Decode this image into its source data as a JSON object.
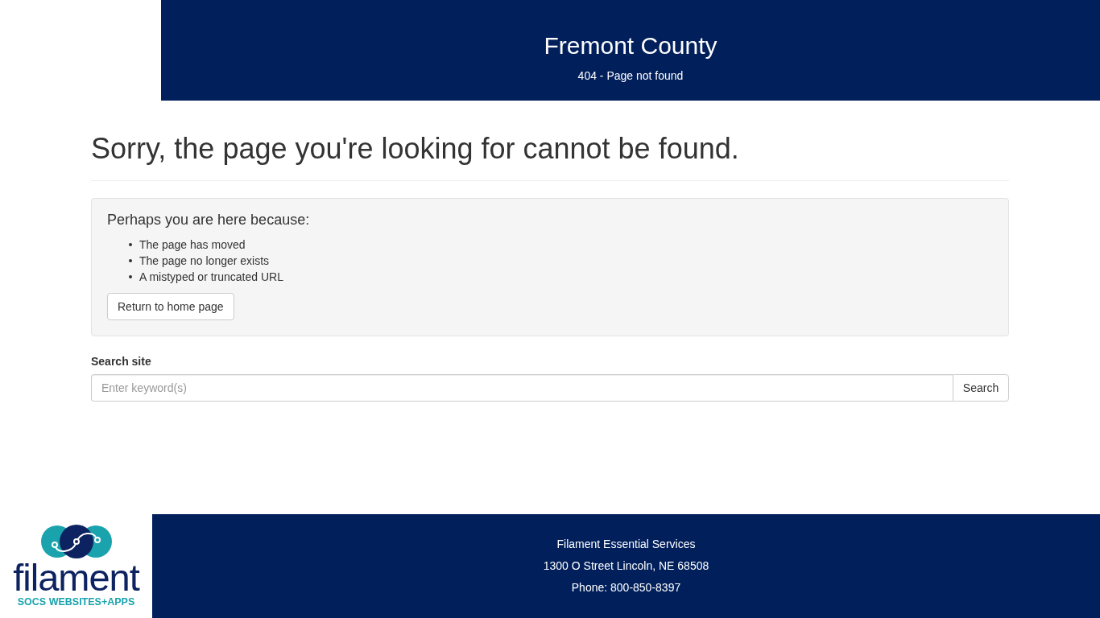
{
  "header": {
    "title": "Fremont County",
    "subtitle": "404 - Page not found"
  },
  "heading": "Sorry, the page you're looking for cannot be found.",
  "reasons_panel": {
    "title": "Perhaps you are here because:",
    "items": [
      "The page has moved",
      "The page no longer exists",
      "A mistyped or truncated URL"
    ],
    "button": "Return to home page"
  },
  "search": {
    "label": "Search site",
    "placeholder": "Enter keyword(s)",
    "button": "Search"
  },
  "footer": {
    "logo": {
      "wordmark": "filament",
      "tagline": "SOCS WEBSITES+APPS"
    },
    "lines": [
      "Filament Essential Services",
      "1300 O Street Lincoln, NE 68508",
      "Phone: 800-850-8397"
    ]
  }
}
